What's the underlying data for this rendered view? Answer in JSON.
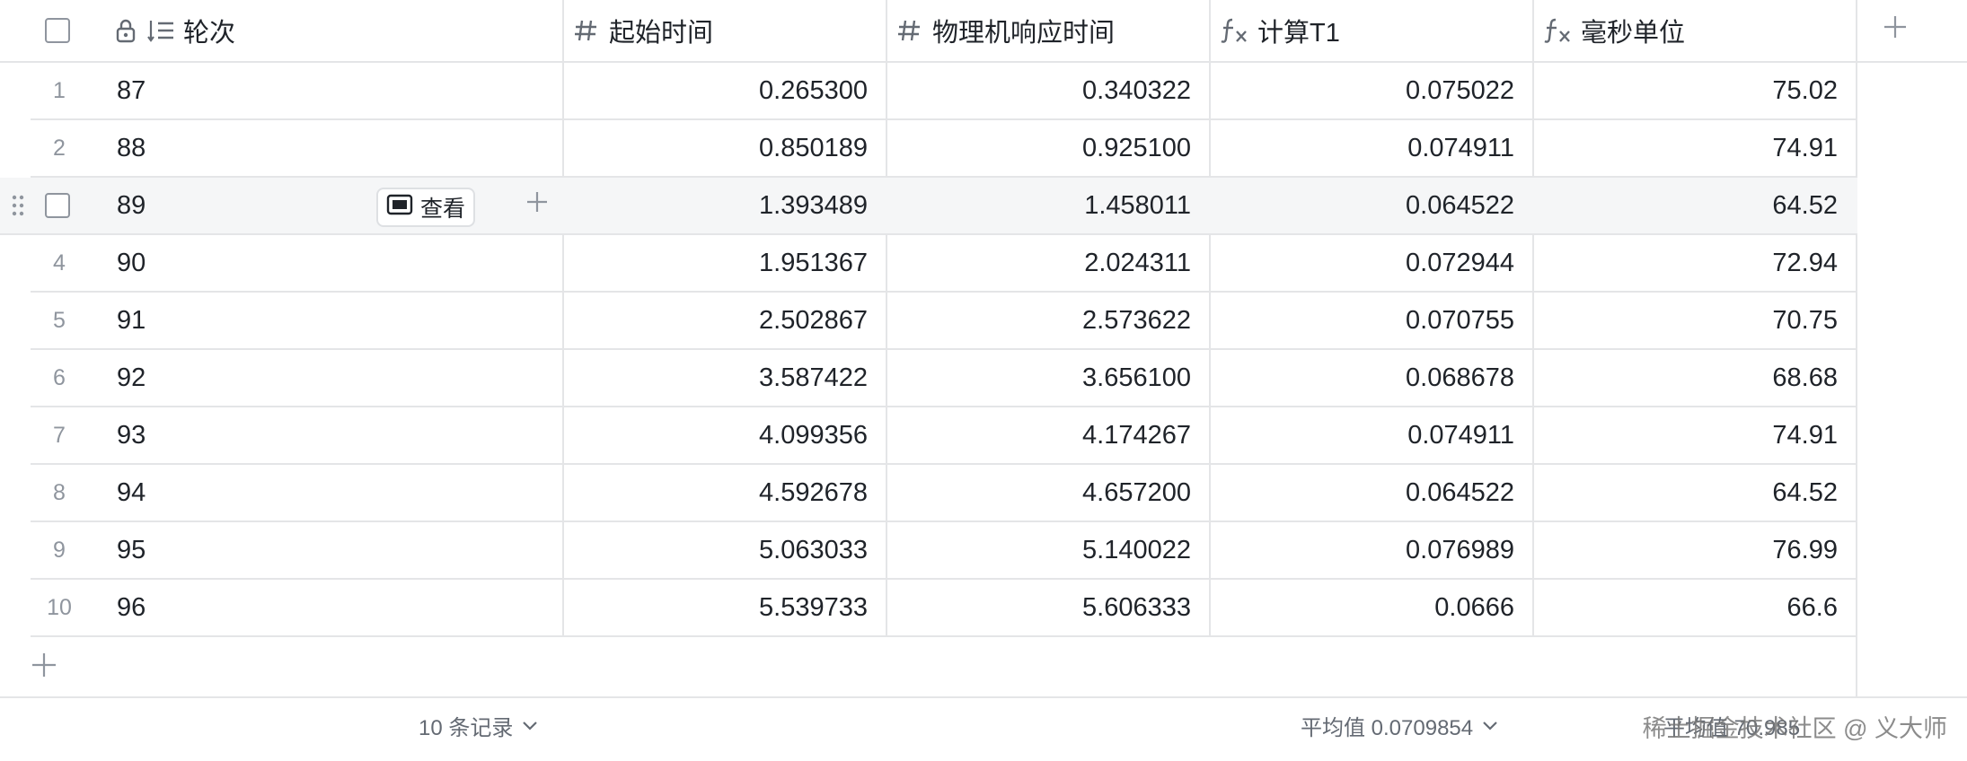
{
  "columns": [
    {
      "label": "轮次",
      "type": "text"
    },
    {
      "label": "起始时间",
      "type": "number"
    },
    {
      "label": "物理机响应时间",
      "type": "number"
    },
    {
      "label": "计算T1",
      "type": "formula"
    },
    {
      "label": "毫秒单位",
      "type": "formula"
    }
  ],
  "rows": [
    {
      "index": "1",
      "round": "87",
      "start": "0.265300",
      "response": "0.340322",
      "t1": "0.075022",
      "ms": "75.02"
    },
    {
      "index": "2",
      "round": "88",
      "start": "0.850189",
      "response": "0.925100",
      "t1": "0.074911",
      "ms": "74.91"
    },
    {
      "index": "",
      "round": "89",
      "start": "1.393489",
      "response": "1.458011",
      "t1": "0.064522",
      "ms": "64.52",
      "hover": true
    },
    {
      "index": "4",
      "round": "90",
      "start": "1.951367",
      "response": "2.024311",
      "t1": "0.072944",
      "ms": "72.94"
    },
    {
      "index": "5",
      "round": "91",
      "start": "2.502867",
      "response": "2.573622",
      "t1": "0.070755",
      "ms": "70.75"
    },
    {
      "index": "6",
      "round": "92",
      "start": "3.587422",
      "response": "3.656100",
      "t1": "0.068678",
      "ms": "68.68"
    },
    {
      "index": "7",
      "round": "93",
      "start": "4.099356",
      "response": "4.174267",
      "t1": "0.074911",
      "ms": "74.91"
    },
    {
      "index": "8",
      "round": "94",
      "start": "4.592678",
      "response": "4.657200",
      "t1": "0.064522",
      "ms": "64.52"
    },
    {
      "index": "9",
      "round": "95",
      "start": "5.063033",
      "response": "5.140022",
      "t1": "0.076989",
      "ms": "76.99"
    },
    {
      "index": "10",
      "round": "96",
      "start": "5.539733",
      "response": "5.606333",
      "t1": "0.0666",
      "ms": "66.6"
    }
  ],
  "row_actions": {
    "view_label": "查看"
  },
  "footer": {
    "record_count": "10 条记录",
    "t1_average": "平均值 0.0709854",
    "ms_average": "平均值 70.985"
  },
  "watermark": "稀土掘金技术社区 @ 义大师",
  "icons": {
    "lock": "lock-icon",
    "ordered_list": "ordered-list-icon",
    "number": "hash-icon",
    "formula": "formula-icon",
    "add": "plus-icon",
    "view": "card-view-icon",
    "drag": "drag-handle-icon",
    "dropdown": "chevron-down-icon"
  },
  "colors": {
    "border": "#e4e5e7",
    "muted": "#8f959e",
    "hover_row": "#f5f6f7",
    "text": "#1f2329"
  }
}
